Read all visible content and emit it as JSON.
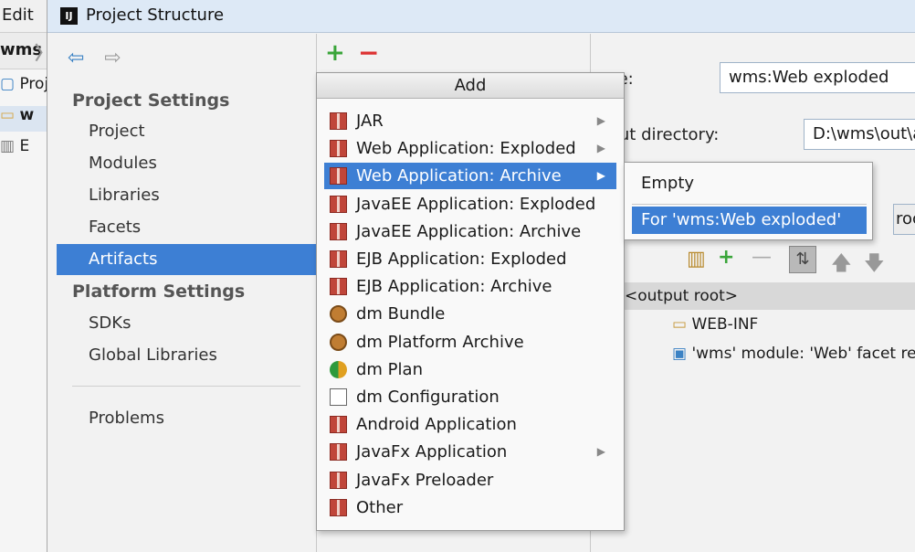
{
  "ide": {
    "menu_edit": "Edit",
    "breadcrumb": "wms",
    "tree": [
      "Proj",
      "w",
      "E"
    ]
  },
  "dialog": {
    "title": "Project Structure",
    "project_settings_header": "Project Settings",
    "project_items": [
      "Project",
      "Modules",
      "Libraries",
      "Facets",
      "Artifacts"
    ],
    "platform_settings_header": "Platform Settings",
    "platform_items": [
      "SDKs",
      "Global Libraries"
    ],
    "problems_label": "Problems",
    "selected_nav": "Artifacts"
  },
  "toolbar": {
    "add_icon": "+",
    "remove_icon": "−"
  },
  "artifact": {
    "name_label": "ame:",
    "name_value": "wms:Web exploded",
    "output_dir_label": "utput directory:",
    "output_dir_value": "D:\\wms\\out\\artifac",
    "tab_partial": "roce",
    "output_root": "<output root>",
    "tree": [
      "WEB-INF",
      "'wms' module: 'Web' facet resour"
    ]
  },
  "add_menu": {
    "header": "Add",
    "items": [
      {
        "label": "JAR",
        "icon": "gift-icon",
        "submenu": true
      },
      {
        "label": "Web Application: Exploded",
        "icon": "gift-icon",
        "submenu": true
      },
      {
        "label": "Web Application: Archive",
        "icon": "gift-icon",
        "submenu": true
      },
      {
        "label": "JavaEE Application: Exploded",
        "icon": "gift-icon",
        "submenu": false
      },
      {
        "label": "JavaEE Application: Archive",
        "icon": "gift-icon",
        "submenu": false
      },
      {
        "label": "EJB Application: Exploded",
        "icon": "gift-icon",
        "submenu": false
      },
      {
        "label": "EJB Application: Archive",
        "icon": "gift-icon",
        "submenu": false
      },
      {
        "label": "dm Bundle",
        "icon": "dm-bundle-icon",
        "submenu": false
      },
      {
        "label": "dm Platform Archive",
        "icon": "dm-platform-icon",
        "submenu": false
      },
      {
        "label": "dm Plan",
        "icon": "dm-plan-icon",
        "submenu": false
      },
      {
        "label": "dm Configuration",
        "icon": "document-icon",
        "submenu": false
      },
      {
        "label": "Android Application",
        "icon": "gift-icon",
        "submenu": false
      },
      {
        "label": "JavaFx Application",
        "icon": "gift-icon",
        "submenu": true
      },
      {
        "label": "JavaFx Preloader",
        "icon": "gift-icon",
        "submenu": false
      },
      {
        "label": "Other",
        "icon": "gift-icon",
        "submenu": false
      }
    ],
    "selected_index": 2
  },
  "submenu": {
    "items": [
      "Empty",
      "For 'wms:Web exploded'"
    ],
    "selected_index": 1
  },
  "colors": {
    "selection": "#3d7fd4",
    "add_green": "#3aa53a",
    "remove_red": "#dd3333"
  }
}
